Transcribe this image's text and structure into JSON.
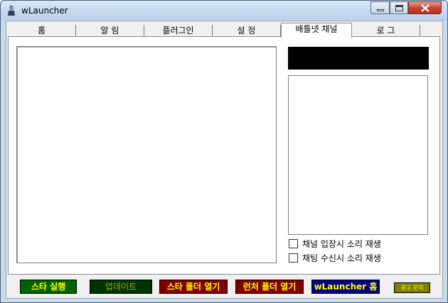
{
  "window": {
    "title": "wLauncher"
  },
  "tabs": [
    {
      "label": "홈",
      "selected": false
    },
    {
      "label": "알  림",
      "selected": false
    },
    {
      "label": "플러그인",
      "selected": false
    },
    {
      "label": "설  정",
      "selected": false
    },
    {
      "label": "배틀넷 채널",
      "selected": true
    },
    {
      "label": "로  그",
      "selected": false
    }
  ],
  "channel": {
    "checkbox_join_sound": {
      "label": "채널 입장시 소리 재생",
      "checked": false
    },
    "checkbox_chat_sound": {
      "label": "채팅 수신시 소리 재생",
      "checked": false
    }
  },
  "buttons": {
    "star_run": {
      "label": "스타 실행",
      "bg": "#006400",
      "fg": "#ffff00"
    },
    "update": {
      "label": "업데이트",
      "bg": "#003300",
      "fg": "#a8a800"
    },
    "open_star_folder": {
      "label": "스타 폴더 열기",
      "bg": "#800000",
      "fg": "#ffff00"
    },
    "open_launcher_folder": {
      "label": "런처 폴더 열기",
      "bg": "#800000",
      "fg": "#ffff00"
    },
    "wlauncher_home": {
      "label": "wLauncher 홈",
      "bg": "#000080",
      "fg": "#ffff00"
    },
    "ad_inquiry": {
      "label": "광고 문의",
      "bg": "#808000",
      "fg": "#ffff00"
    }
  }
}
